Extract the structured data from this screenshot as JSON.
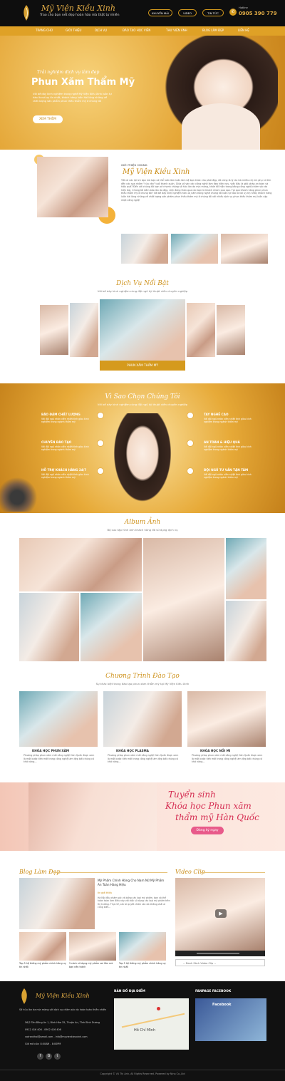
{
  "header": {
    "logo_script": "Mỹ Viện Kiều Xinh",
    "tagline": "Trao cho bạn nét đẹp hoàn hảo mà thật tự nhiên",
    "buttons": [
      "KHUYẾN MÃI",
      "VIDEO",
      "TIN TỨC"
    ],
    "hotline_label": "Hotline",
    "hotline": "0905 390 779"
  },
  "nav": [
    "TRANG CHỦ",
    "GIỚI THIỆU",
    "DỊCH VỤ",
    "ĐÀO TẠO HỌC VIÊN",
    "THƯ VIỆN ẢNH",
    "BLOG LÀM ĐẸP",
    "LIÊN HỆ"
  ],
  "hero": {
    "script": "Trải nghiệm dịch vụ làm đẹp",
    "title": "Phun Xăm Thẩm Mỹ",
    "text": "Với bề dày kinh nghiệm trong nghề Mỹ Viện Kiều Xinh luôn tự hào là nơi uy tín nhất, khách hàng luôn hài lòng những về chất lượng sản phẩm phun thêu thẩm mỹ ở chúng tôi",
    "button": "XEM THÊM"
  },
  "intro": {
    "label": "GIỚI THIỆU CHUNG",
    "title": "Mỹ Viện Kiều Xinh",
    "text": "Tất cả các lợi ích bạn mà bạn có thể luôn làm luôn làm bệ bạn khác của phái đẹp, đó cũng là lý do mà nhiều chị em phụ nữ tìm đến các spa nhằm \"cứu vãn\" tuổi thanh xuân. Giữa vô vàn các công nghệ làm đẹp hiện nay, việc đâu là giải pháp an toàn và hiệu quả? Đến với chúng tôi bạn sẽ nhanh chóng sở hữu làn da mịn màng, khỏe tối hiện trong bằng công nghệ chăm sóc da hiện đại. Chúng tôi đảm bảo làn da đẹp, việc đáng thán qua các bạn là khách nhàm qua spa. Tại spa khách hàng phun phun thêu thẩm mỹ ở chúng tôi? Với bề dày kinh nghiệm hơn 10 năm trong nghề chúng tôi luôn tự hào là nơi uy tín nhất, khách hàng luôn hài lòng những về chất lượng sản phẩm phun thêu thẩm mỹ ở chúng tôi với nhiều dịch vụ phun thêu thẩm mỹ luôn cập nhật công nghệ"
  },
  "services": {
    "title": "Dịch Vụ Nổi Bật",
    "subtitle": "Với bề dày kinh nghiệm cùng đội ngũ kỹ thuật viên chuyên nghiệp",
    "featured_label": "PHUN XĂM THẨM MỸ"
  },
  "why": {
    "title": "Vì Sao Chọn Chúng Tôi",
    "subtitle": "Với bề dày kinh nghiệm cùng đội ngũ kỹ thuật viên chuyên nghiệp",
    "items": [
      {
        "t": "BẢO ĐẢM CHẤT LƯỢNG",
        "d": "Với đội ngũ nhân viên nhiệt tình giàu kinh nghiệm trong ngành thẩm mỹ"
      },
      {
        "t": "CHUYÊN ĐÀO TẠO",
        "d": "Với đội ngũ nhân viên nhiệt tình giàu kinh nghiệm trong ngành thẩm mỹ"
      },
      {
        "t": "HỖ TRỢ KHÁCH HÀNG 24/7",
        "d": "Với đội ngũ nhân viên nhiệt tình giàu kinh nghiệm trong ngành thẩm mỹ"
      },
      {
        "t": "TAY NGHỀ CAO",
        "d": "Với đội ngũ nhân viên nhiệt tình giàu kinh nghiệm trong ngành thẩm mỹ"
      },
      {
        "t": "AN TOÀN & HIỆU QUẢ",
        "d": "Với đội ngũ nhân viên nhiệt tình giàu kinh nghiệm trong ngành thẩm mỹ"
      },
      {
        "t": "ĐỘI NGŨ TƯ VẤN TẬN TÂM",
        "d": "Với đội ngũ nhân viên nhiệt tình giàu kinh nghiệm trong ngành thẩm mỹ"
      }
    ]
  },
  "album": {
    "title": "Album Ảnh",
    "subtitle": "Bộ sưu tập hình ảnh khách hàng đã sử dụng dịch vụ"
  },
  "training": {
    "title": "Chương Trình Đào Tạo",
    "subtitle": "Sự khác biệt trong đào tạo phun xăm thẩm mỹ tại Mỹ Viện Kiều Xinh",
    "courses": [
      {
        "label": "KHÓA HỌC PHUN XĂM",
        "text": "Phương pháp phun xăm mới công nghệ Hàn Quốc được xem là một bước tiến mới trong công nghệ làm đẹp bởi chúng có khả năng..."
      },
      {
        "label": "KHÓA HỌC PLASMA",
        "text": "Phương pháp phun xăm mới công nghệ Hàn Quốc được xem là một bước tiến mới trong công nghệ làm đẹp bởi chúng có khả năng..."
      },
      {
        "label": "KHÓA HỌC NỐI MI",
        "text": "Phương pháp phun xăm mới công nghệ Hàn Quốc được xem là một bước tiến mới trong công nghệ làm đẹp bởi chúng có khả năng..."
      }
    ]
  },
  "banner": {
    "line1": "Tuyển sinh",
    "line2": "Khóa học Phun xăm",
    "line3": "thẩm mỹ Hàn Quốc",
    "button": "Đăng ký ngay"
  },
  "blog": {
    "title": "Blog Làm Đẹp",
    "main_title": "Mỹ Phẩm Chính Hãng Cho Nam Nữ Mỹ Phẩm An Toàn Hàng Hiệu",
    "main_tag": "tin giới thiệu",
    "main_text": "Hà Nội đầu chăm sóc và bổng các loại mỹ phẩm, bạn có thể hoàn toàn làm điều này với việc sử dụng các loại mỹ phẩm trên thị trường. Thực tế, các bí quyết chăm sóc da không phải ai cũng biết...",
    "small": [
      "Top 5 hệ thống mỹ phẩm chính hãng uy tín nhất",
      "5 cách xử dụng mỹ phẩm sai lầm mà bạn nên tránh",
      "Top 5 hệ thống mỹ phẩm chính hãng uy tín nhất"
    ]
  },
  "video": {
    "title": "Video Clip",
    "select": "-- Danh Sách Video Clip --"
  },
  "footer": {
    "logo": "Mỹ Viện Kiều Xinh",
    "desc": "Sở hữu làn da mịn màng với dịch vụ chăm sóc da hoàn toàn thiên nhiên",
    "address": "56/2 Tân Đông An 1, Bình Hòa 35, Thuận An, Tỉnh Bình Dương",
    "phone": "0912 416 406 - 0902 416 406",
    "email": "votrankhoi@gmail.com - info@myvienkieuxinh.com",
    "hours": "Giờ mở cửa: 8:00AM - 8:00PM",
    "map_title": "BẢN ĐỒ ĐỊA ĐIỂM",
    "map_city": "Hồ Chí Minh",
    "fb_title": "FANPAGE FACEBOOK",
    "fb_name": "Facebook",
    "copyright": "Copyright © Vũ Thị Anh. All Rights Reserved. Powered by Nina Co.,Ltd"
  },
  "colors": {
    "gold": "#dfa126",
    "dark": "#0e0e0e"
  }
}
